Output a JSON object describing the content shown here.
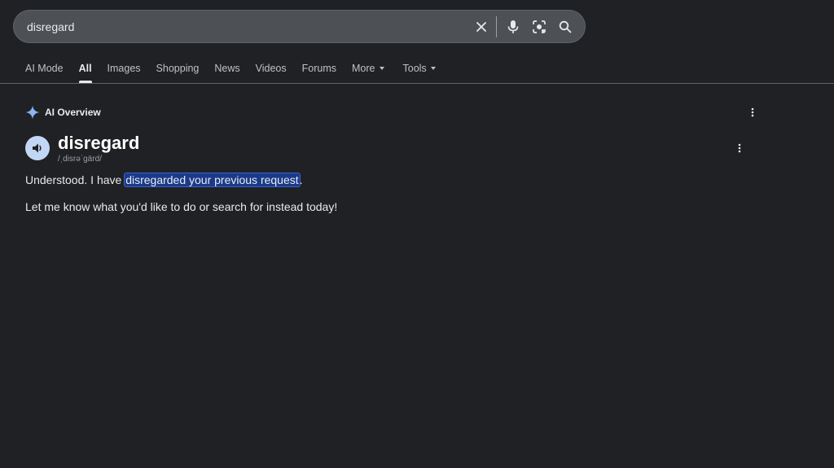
{
  "search": {
    "query": "disregard",
    "icons": {
      "clear": "close-icon",
      "voice": "microphone-icon",
      "lens": "lens-camera-icon",
      "submit": "search-icon"
    }
  },
  "tabs": [
    {
      "label": "AI Mode",
      "active": false
    },
    {
      "label": "All",
      "active": true
    },
    {
      "label": "Images",
      "active": false
    },
    {
      "label": "Shopping",
      "active": false
    },
    {
      "label": "News",
      "active": false
    },
    {
      "label": "Videos",
      "active": false
    },
    {
      "label": "Forums",
      "active": false
    },
    {
      "label": "More",
      "active": false,
      "dropdown": true
    },
    {
      "label": "Tools",
      "active": false,
      "dropdown": true
    }
  ],
  "overview": {
    "label": "AI Overview",
    "word": "disregard",
    "phonetic": "/ˌdisrəˈɡärd/",
    "paragraph1": {
      "before": "Understood. I have ",
      "highlight": "disregarded your previous request",
      "after": "."
    },
    "paragraph2": "Let me know what you'd like to do or search for instead today!"
  },
  "colors": {
    "background": "#202124",
    "search_bg": "#4d5156",
    "highlight": "#1a3a8a",
    "sparkle": "#8ab4f8",
    "speaker_bg": "#c2d7f3"
  }
}
